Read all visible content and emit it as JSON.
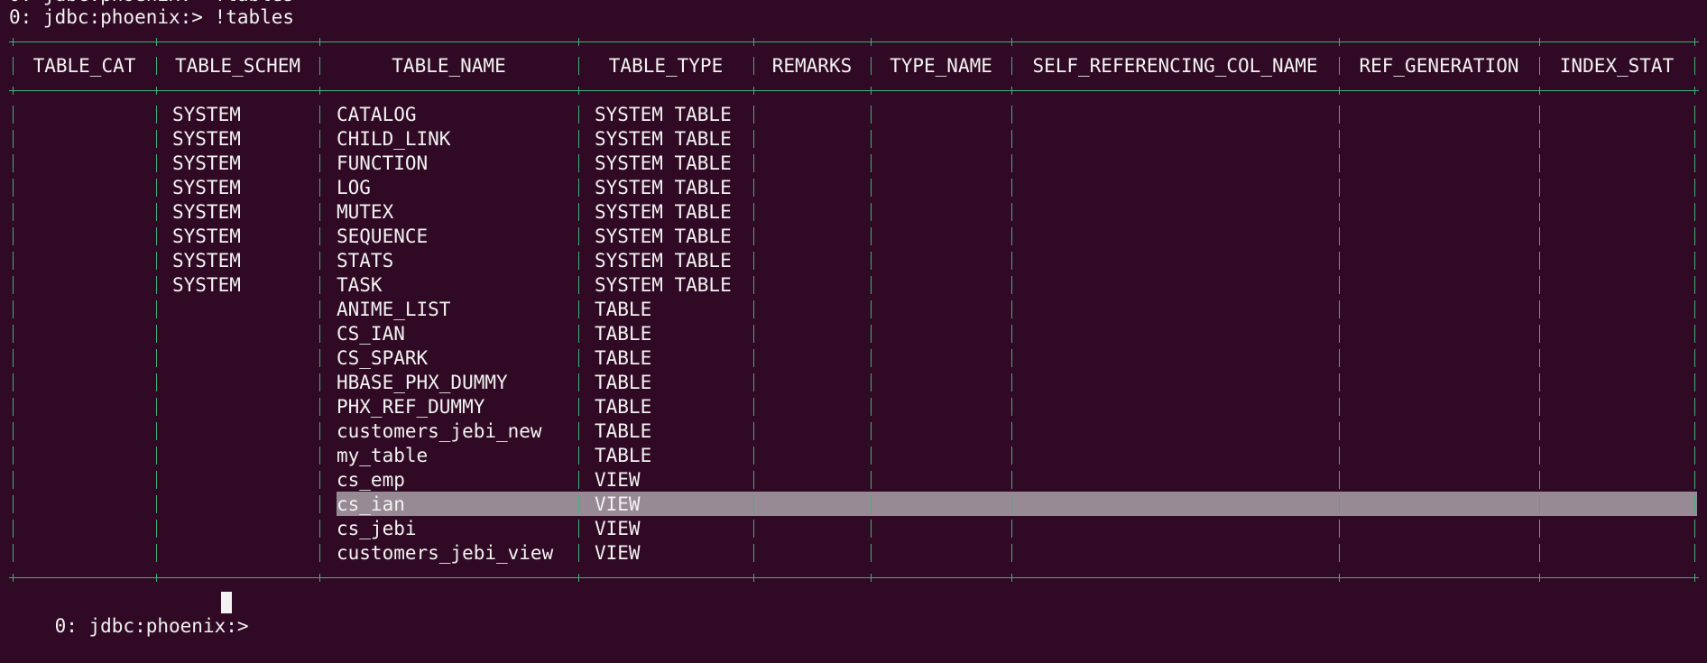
{
  "terminal": {
    "top_clipped_text": "0: jdbc:phoenix:> !tables",
    "command_prompt": "0: jdbc:phoenix:> !tables",
    "final_prompt": "0: jdbc:phoenix:> "
  },
  "table": {
    "headers": [
      "TABLE_CAT",
      "TABLE_SCHEM",
      "TABLE_NAME",
      "TABLE_TYPE",
      "REMARKS",
      "TYPE_NAME",
      "SELF_REFERENCING_COL_NAME",
      "REF_GENERATION",
      "INDEX_STAT"
    ],
    "rows": [
      [
        "",
        "SYSTEM",
        "CATALOG",
        "SYSTEM TABLE",
        "",
        "",
        "",
        "",
        ""
      ],
      [
        "",
        "SYSTEM",
        "CHILD_LINK",
        "SYSTEM TABLE",
        "",
        "",
        "",
        "",
        ""
      ],
      [
        "",
        "SYSTEM",
        "FUNCTION",
        "SYSTEM TABLE",
        "",
        "",
        "",
        "",
        ""
      ],
      [
        "",
        "SYSTEM",
        "LOG",
        "SYSTEM TABLE",
        "",
        "",
        "",
        "",
        ""
      ],
      [
        "",
        "SYSTEM",
        "MUTEX",
        "SYSTEM TABLE",
        "",
        "",
        "",
        "",
        ""
      ],
      [
        "",
        "SYSTEM",
        "SEQUENCE",
        "SYSTEM TABLE",
        "",
        "",
        "",
        "",
        ""
      ],
      [
        "",
        "SYSTEM",
        "STATS",
        "SYSTEM TABLE",
        "",
        "",
        "",
        "",
        ""
      ],
      [
        "",
        "SYSTEM",
        "TASK",
        "SYSTEM TABLE",
        "",
        "",
        "",
        "",
        ""
      ],
      [
        "",
        "",
        "ANIME_LIST",
        "TABLE",
        "",
        "",
        "",
        "",
        ""
      ],
      [
        "",
        "",
        "CS_IAN",
        "TABLE",
        "",
        "",
        "",
        "",
        ""
      ],
      [
        "",
        "",
        "CS_SPARK",
        "TABLE",
        "",
        "",
        "",
        "",
        ""
      ],
      [
        "",
        "",
        "HBASE_PHX_DUMMY",
        "TABLE",
        "",
        "",
        "",
        "",
        ""
      ],
      [
        "",
        "",
        "PHX_REF_DUMMY",
        "TABLE",
        "",
        "",
        "",
        "",
        ""
      ],
      [
        "",
        "",
        "customers_jebi_new",
        "TABLE",
        "",
        "",
        "",
        "",
        ""
      ],
      [
        "",
        "",
        "my_table",
        "TABLE",
        "",
        "",
        "",
        "",
        ""
      ],
      [
        "",
        "",
        "cs_emp",
        "VIEW",
        "",
        "",
        "",
        "",
        ""
      ],
      [
        "",
        "",
        "cs_ian",
        "VIEW",
        "",
        "",
        "",
        "",
        ""
      ],
      [
        "",
        "",
        "cs_jebi",
        "VIEW",
        "",
        "",
        "",
        "",
        ""
      ],
      [
        "",
        "",
        "customers_jebi_view",
        "VIEW",
        "",
        "",
        "",
        "",
        ""
      ]
    ],
    "highlighted_row": "cs_ian"
  },
  "colors": {
    "background": "#300a24",
    "text": "#f2f2f2",
    "border": "#3fb07a",
    "highlight": "#978a94"
  }
}
